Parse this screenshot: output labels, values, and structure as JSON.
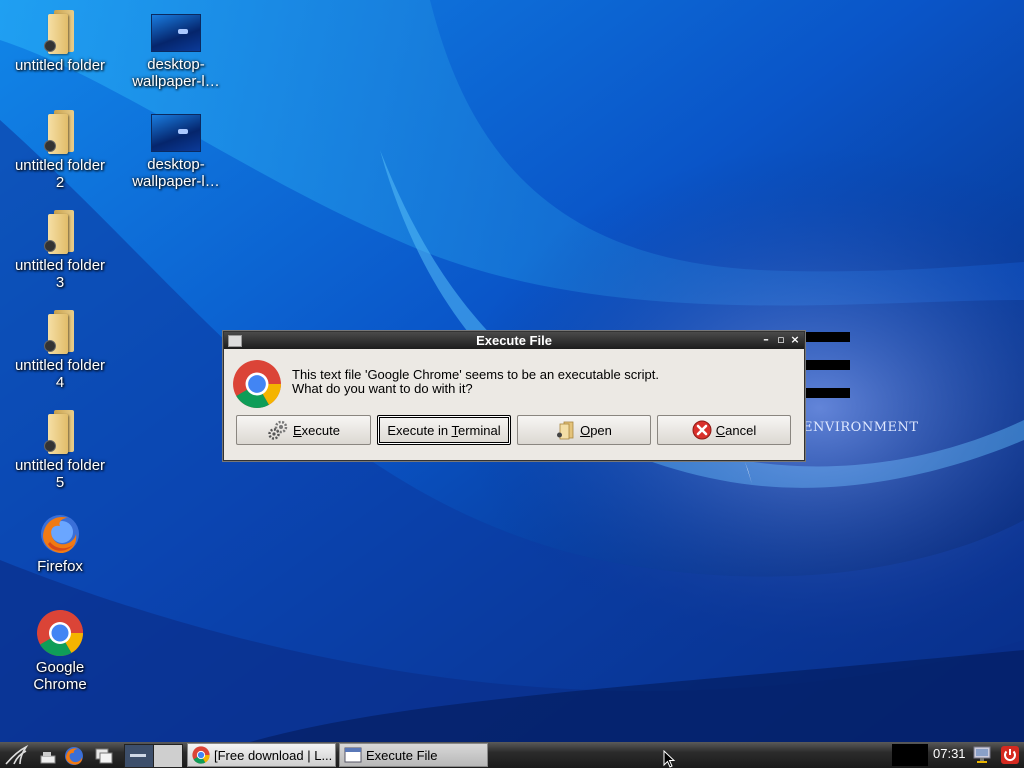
{
  "desktop": {
    "icons": [
      {
        "label_line1": "untitled folder",
        "label_line2": ""
      },
      {
        "label_line1": "untitled folder",
        "label_line2": "2"
      },
      {
        "label_line1": "untitled folder",
        "label_line2": "3"
      },
      {
        "label_line1": "untitled folder",
        "label_line2": "4"
      },
      {
        "label_line1": "untitled folder",
        "label_line2": "5"
      },
      {
        "label_line1": "Firefox",
        "label_line2": ""
      },
      {
        "label_line1": "Google",
        "label_line2": "Chrome"
      },
      {
        "label_line1": "desktop-",
        "label_line2": "wallpaper-l…"
      },
      {
        "label_line1": "desktop-",
        "label_line2": "wallpaper-l…"
      }
    ],
    "wallpaper_text": "ENVIRONMENT"
  },
  "dialog": {
    "title": "Execute File",
    "message_line1": "This text file 'Google Chrome' seems to be an executable script.",
    "message_line2": "What do you want to do with it?",
    "buttons": {
      "execute_pre": "",
      "execute_mnemonic": "E",
      "execute_post": "xecute",
      "terminal_pre": "Execute in ",
      "terminal_mnemonic": "T",
      "terminal_post": "erminal",
      "open_pre": "",
      "open_mnemonic": "O",
      "open_post": "pen",
      "cancel_pre": "",
      "cancel_mnemonic": "C",
      "cancel_post": "ancel"
    },
    "title_controls": {
      "minimize": "–",
      "maximize": "▫",
      "close": "×"
    }
  },
  "taskbar": {
    "tasks": [
      {
        "label": "[Free download | L..."
      },
      {
        "label": "Execute File"
      }
    ],
    "clock": "07:31"
  },
  "colors": {
    "wallpaper_dark": "#06206b",
    "wallpaper_bright": "#1a9bf0",
    "dialog_bg": "#ece9e4",
    "titlebar": "#2a2a2a",
    "cancel_red": "#d9302b"
  }
}
